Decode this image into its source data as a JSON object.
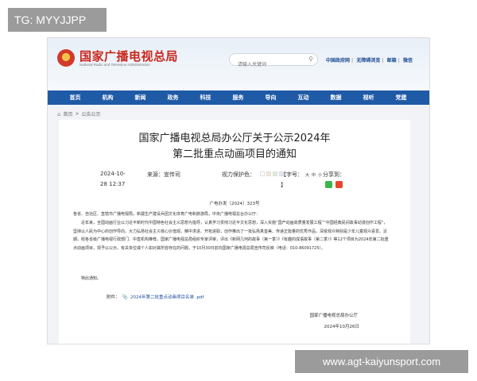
{
  "overlay": {
    "tag": "TG: MYYJJPP",
    "footer": "www.agt-kaiyunsport.com"
  },
  "site": {
    "title": "国家广播电视总局",
    "subtitle": "National Radio and Television Administration",
    "search_placeholder": "请输入关键词",
    "top_links": [
      "中国政府网",
      "无障碍浏览",
      "邮箱",
      "微信"
    ]
  },
  "nav": [
    "首页",
    "机构",
    "新闻",
    "政务",
    "科技",
    "服务",
    "导向",
    "互动",
    "数据",
    "视听",
    "党建"
  ],
  "breadcrumb": {
    "home": "首页",
    "section": "公告公示",
    "sep": ">"
  },
  "doc": {
    "title_line1": "国家广播电视总局办公厅关于公示2024年",
    "title_line2": "第二批重点动画项目的通知",
    "date_line1": "2024-10-",
    "date_line2": "28 12:37",
    "source": "来源：宣传司",
    "vision_label": "视力保护色：",
    "font_label": "【字号：",
    "font_sizes": [
      "大",
      "中",
      "小"
    ],
    "font_close": "】",
    "share_label": "分享到：",
    "number": "广电办发〔2024〕323号",
    "addressee": "各省、自治区、直辖市广播电视局，新疆生产建设兵团文化体育广电和旅游局，中央广播电视总台办公厅：",
    "para1": "近年来，全国动画行业以习近平新时代中国特色社会主义思想为指导，认真学习贯彻习近平文化思想，深入实施“国产动画高质量发展工程”“中国经典民间故事动漫创作工程”，坚持以人民为中心的创作导向，大力弘扬社会主义核心价值观，精中求进、开拓进取，创作推出了一批弘扬真善美、传递正能量的优秀作品，深受观众特别是少年儿童观众喜爱。近期，经各省级广播电视行政部门、中直机构推荐，国家广播电视总局组织专家评审，评出《新网几何的故事（第一季）》《有趣的成语故事（第二季）》等12个项目为2024年第二批重点动画项目，现予以公示。有关单位或个人如对其所容存在的问题，于10月30日前向国家广播电视总局宣传司反映（电话：010-86091725）。",
    "para2": "特此通知。",
    "attachment_label": "附件：",
    "attachment_link": "2024年第二批重点动画项目名单 .pdf",
    "sign_org": "国家广播电视总局办公厅",
    "sign_date": "2024年10月26日"
  },
  "colors": {
    "brand_red": "#c8281d",
    "nav_blue": "#1f5aa6",
    "swatches": [
      "#ffffff",
      "#f6e9c9",
      "#dbeedb",
      "#dfe8f6",
      "#eeeeee"
    ]
  },
  "icons": [
    "emblem-icon",
    "search-icon",
    "home-icon",
    "paperclip-icon",
    "wechat-icon",
    "weibo-icon"
  ]
}
